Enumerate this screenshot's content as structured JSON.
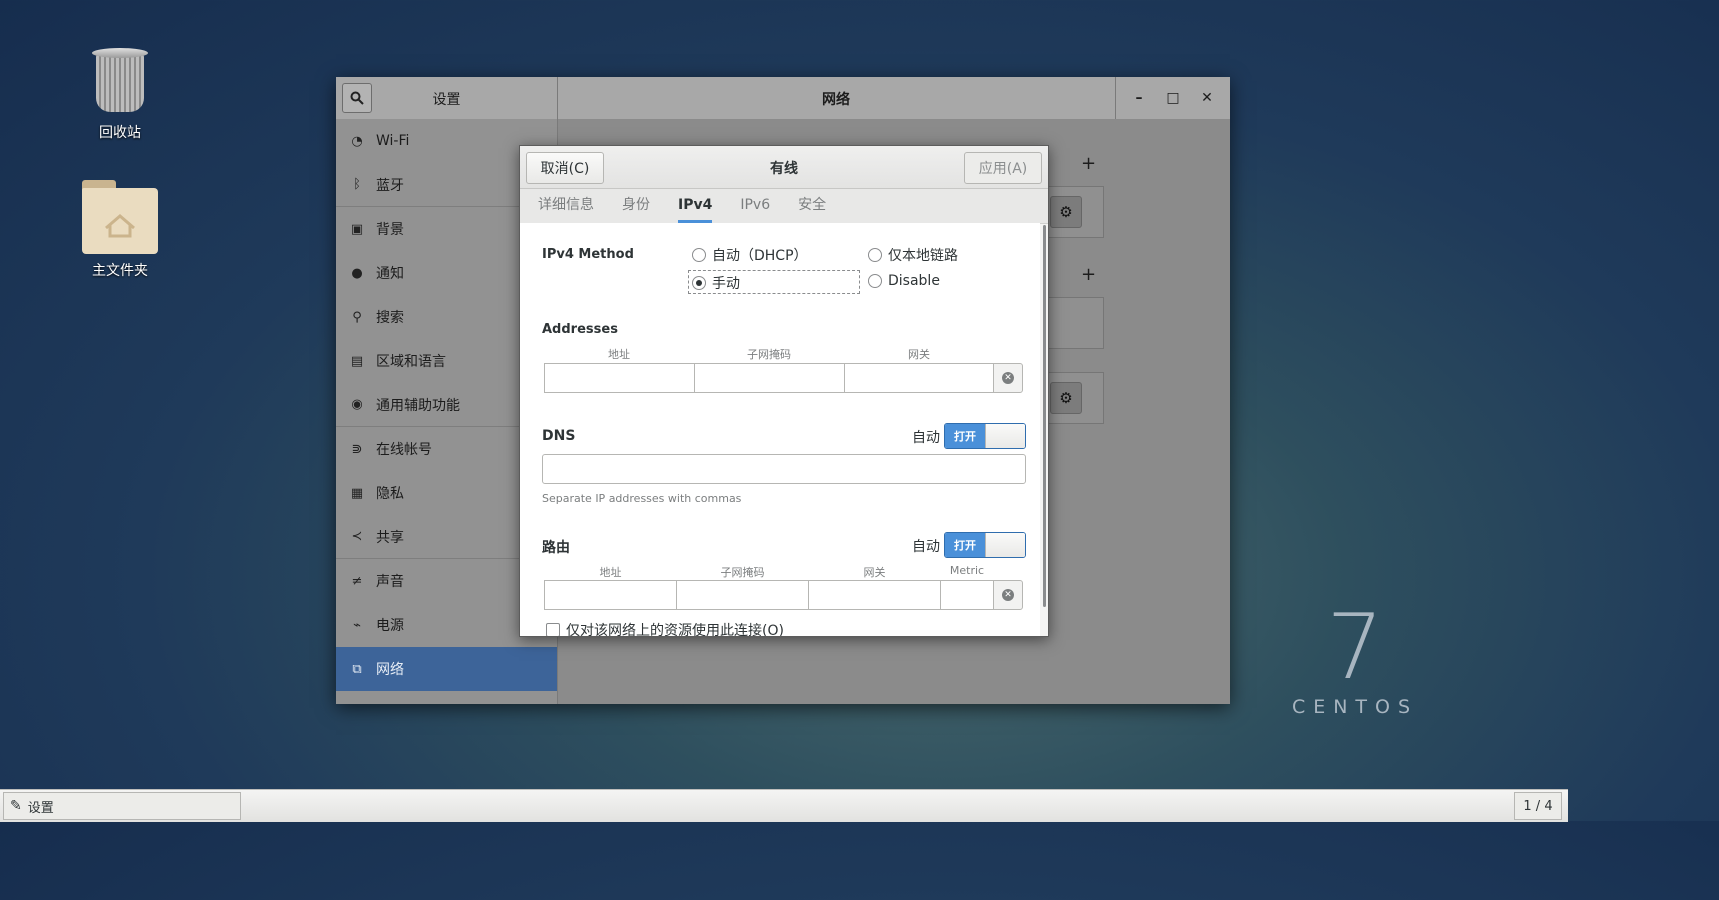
{
  "desktop": {
    "trash_label": "回收站",
    "home_label": "主文件夹",
    "centos_number": "7",
    "centos_word": "CENTOS"
  },
  "settings": {
    "sidebar_title": "设置",
    "panel_title": "网络",
    "window_controls": [
      "–",
      "□",
      "✕"
    ],
    "sidebar_items": [
      {
        "label": "Wi-Fi",
        "icon": "wifi-icon"
      },
      {
        "label": "蓝牙",
        "icon": "bluetooth-icon"
      },
      {
        "label": "背景",
        "icon": "background-icon"
      },
      {
        "label": "通知",
        "icon": "notification-icon"
      },
      {
        "label": "搜索",
        "icon": "search-icon"
      },
      {
        "label": "区域和语言",
        "icon": "region-icon"
      },
      {
        "label": "通用辅助功能",
        "icon": "accessibility-icon"
      },
      {
        "label": "在线帐号",
        "icon": "online-accounts-icon"
      },
      {
        "label": "隐私",
        "icon": "privacy-icon"
      },
      {
        "label": "共享",
        "icon": "share-icon"
      },
      {
        "label": "声音",
        "icon": "sound-icon"
      },
      {
        "label": "电源",
        "icon": "power-icon"
      },
      {
        "label": "网络",
        "icon": "network-icon"
      }
    ],
    "selected_item": "网络"
  },
  "dialog": {
    "cancel_label": "取消(C)",
    "title": "有线",
    "apply_label": "应用(A)",
    "tabs": [
      "详细信息",
      "身份",
      "IPv4",
      "IPv6",
      "安全"
    ],
    "active_tab": "IPv4",
    "ipv4_method_label": "IPv4 Method",
    "methods": {
      "auto_dhcp": "自动（DHCP）",
      "link_local": "仅本地链路",
      "manual": "手动",
      "disable": "Disable"
    },
    "selected_method": "手动",
    "addresses_label": "Addresses",
    "address_columns": [
      "地址",
      "子网掩码",
      "网关"
    ],
    "dns_label": "DNS",
    "dns_auto_label": "自动",
    "dns_auto_state": "打开",
    "dns_value": "",
    "dns_hint": "Separate IP addresses with commas",
    "routes_label": "路由",
    "routes_auto_label": "自动",
    "routes_auto_state": "打开",
    "route_columns": [
      "地址",
      "子网掩码",
      "网关",
      "Metric"
    ],
    "only_local_resources_label": "仅对该网络上的资源使用此连接(O)"
  },
  "taskbar": {
    "task_label": "设置",
    "pager": "1 / 4"
  }
}
